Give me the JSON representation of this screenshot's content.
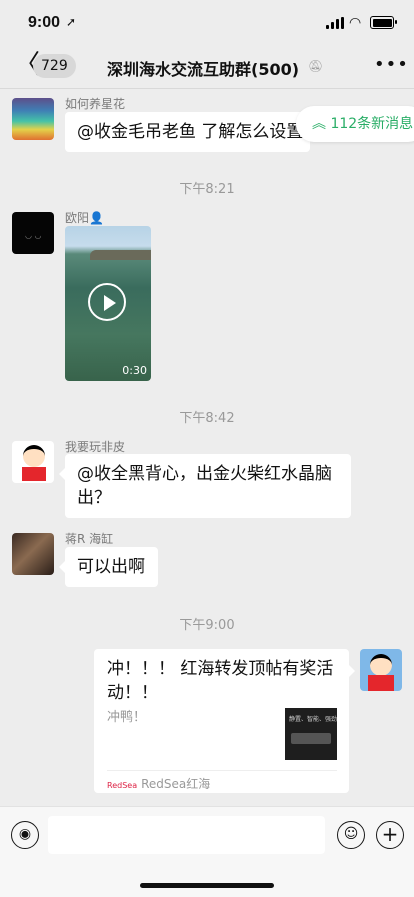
{
  "status": {
    "time": "9:00",
    "location": "➚",
    "wifi": "Wi-Fi"
  },
  "header": {
    "unread_count": "729",
    "title": "深圳海水交流互助群(500)",
    "back": "〈",
    "mute": "mute-bell-icon",
    "more": "•••"
  },
  "new_messages": {
    "label": "112条新消息",
    "icon": "double-chevron-up-icon"
  },
  "messages": [
    {
      "sender": "如何养星花",
      "text": "@收金毛吊老鱼 了解怎么设置"
    },
    {
      "timestamp": "下午8:21"
    },
    {
      "sender": "欧阳👤",
      "type": "video",
      "duration": "0:30"
    },
    {
      "timestamp": "下午8:42"
    },
    {
      "sender": "我要玩非皮",
      "text": "@收全黑背心，出金火柴红水晶脑出？"
    },
    {
      "sender": "蒋R 海缸",
      "text": "可以出啊"
    },
    {
      "timestamp": "下午9:00"
    },
    {
      "type": "link-card",
      "title": "冲！！！ 红海转发顶帖有奖活动！！",
      "desc": "冲鸭！",
      "thumb_text": "静置、智能、强劲",
      "source": "RedSea红海",
      "source_logo": "RedSea"
    }
  ],
  "input": {
    "placeholder": ""
  },
  "icons": {
    "voice": "◉",
    "emoji": "☺",
    "plus": "+"
  }
}
